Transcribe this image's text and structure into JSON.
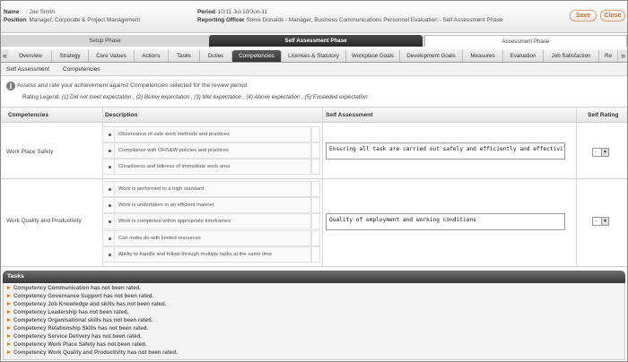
{
  "header": {
    "name_label": "Name",
    "name_value": ": Joe Smith",
    "position_label": "Position",
    "position_value": ": Manager, Corporate & Project Management",
    "period_label": "Period",
    "period_value": ": 10/11 Jul-10/Jun-11",
    "officer_label": "Reporting Officer",
    "officer_value": ": Steve Donalds - Manager, Business Communications  Personnel Evaluation - Self Assessment Phase",
    "save_label": "Save",
    "close_label": "Close"
  },
  "phases": [
    "Setup Phase",
    "Self Assessment Phase",
    "Assessment Phase"
  ],
  "tabs": [
    "Overview",
    "Strategy",
    "Core Values",
    "Actions",
    "Tasks",
    "Duties",
    "Competencies",
    "Licenses & Statutory",
    "Workplace Goals",
    "Development Goals",
    "Measures",
    "Evaluation",
    "Job Satisfaction",
    "Re"
  ],
  "nav": {
    "prev": "«",
    "next": "»"
  },
  "breadcrumb": [
    "Self Assessment",
    "Competencies"
  ],
  "intro": {
    "info": "i",
    "text": "Assess and rate your achievement against Competencies selected for the review period.",
    "legend_label": "Rating Legend:",
    "legend_values": "(1) Did not meet expectation , (2) Below expectation , (3) Met expectation , (4) Above expectation , (5) Exceeded expectation"
  },
  "table": {
    "headers": [
      "Competencies",
      "Description",
      "Self Assessment",
      "Self Rating"
    ],
    "rows": [
      {
        "competency": "Work Place Safety",
        "descriptions": [
          "Observance of safe work methods and practices",
          "Compliance with OHS&W policies and practices",
          "Cleanliness and tidiness of immediate work area"
        ],
        "assessment": "Ensuring all task are carried out safely and efficiently and effectivily",
        "rating": "-"
      },
      {
        "competency": "Work Quality and Productivity",
        "descriptions": [
          "Work is performed to a high standard",
          "Work is undertaken in an efficient manner",
          "Work is completed within appropriate timeframes",
          "Can make do with limited resources",
          "Ability to handle and follow through multiple tasks at the same time"
        ],
        "assessment": "Quality of employment and working conditions",
        "rating": "-"
      }
    ]
  },
  "tasks": {
    "title": "Tasks",
    "items": [
      "Competency Communication has not been rated.",
      "Competency Governance Support has not been rated.",
      "Competency Job Knowledge and skills has not been rated.",
      "Competency Leadership has not been rated.",
      "Competency Organisational skills has not been rated.",
      "Competency Relationship Skills has not been rated.",
      "Competency Service Delivery has not been rated.",
      "Competency Work Place Safety has not been rated.",
      "Competency Work Quality and Productivity has not been rated."
    ]
  }
}
